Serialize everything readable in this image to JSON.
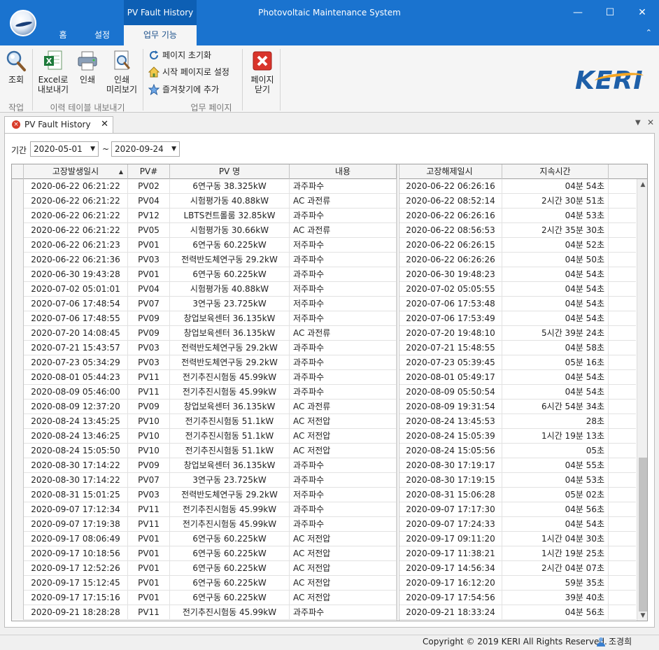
{
  "window": {
    "title": "Photovoltaic Maintenance System",
    "context_tab": "PV Fault History",
    "minimize": "—",
    "maximize": "☐",
    "close": "✕"
  },
  "tabs": [
    "홈",
    "설정",
    "업무 기능"
  ],
  "ribbon": {
    "groups": [
      "작업",
      "이력 테이블 내보내기",
      "업무 페이지"
    ],
    "buttons": {
      "search": "조회",
      "export_excel_1": "Excel로",
      "export_excel_2": "내보내기",
      "print": "인쇄",
      "preview_1": "인쇄",
      "preview_2": "미리보기",
      "page_reset": "페이지 초기화",
      "set_start_page": "시작 페이지로 설정",
      "add_favorite": "즐겨찾기에 추가",
      "close_page_1": "페이지",
      "close_page_2": "닫기"
    },
    "logo": "KERI"
  },
  "document_tab": {
    "title": "PV Fault History"
  },
  "filter": {
    "label": "기간",
    "from": "2020-05-01",
    "to": "2020-09-24",
    "separator": "~"
  },
  "table": {
    "columns": [
      "고장발생일시",
      "PV#",
      "PV 명",
      "내용",
      "고장해제일시",
      "지속시간"
    ],
    "sort_indicator": "▲",
    "rows": [
      [
        "2020-06-22 06:21:22",
        "PV02",
        "6연구동 38.325kW",
        "과주파수",
        "2020-06-22 06:26:16",
        "04분 54초"
      ],
      [
        "2020-06-22 06:21:22",
        "PV04",
        "시험평가동 40.88kW",
        "AC 과전류",
        "2020-06-22 08:52:14",
        "2시간 30분 51초"
      ],
      [
        "2020-06-22 06:21:22",
        "PV12",
        "LBTS컨트롤룸 32.85kW",
        "과주파수",
        "2020-06-22 06:26:16",
        "04분 53초"
      ],
      [
        "2020-06-22 06:21:22",
        "PV05",
        "시험평가동 30.66kW",
        "AC 과전류",
        "2020-06-22 08:56:53",
        "2시간 35분 30초"
      ],
      [
        "2020-06-22 06:21:23",
        "PV01",
        "6연구동 60.225kW",
        "저주파수",
        "2020-06-22 06:26:15",
        "04분 52초"
      ],
      [
        "2020-06-22 06:21:36",
        "PV03",
        "전력반도체연구동 29.2kW",
        "과주파수",
        "2020-06-22 06:26:26",
        "04분 50초"
      ],
      [
        "2020-06-30 19:43:28",
        "PV01",
        "6연구동 60.225kW",
        "과주파수",
        "2020-06-30 19:48:23",
        "04분 54초"
      ],
      [
        "2020-07-02 05:01:01",
        "PV04",
        "시험평가동 40.88kW",
        "저주파수",
        "2020-07-02 05:05:55",
        "04분 54초"
      ],
      [
        "2020-07-06 17:48:54",
        "PV07",
        "3연구동 23.725kW",
        "저주파수",
        "2020-07-06 17:53:48",
        "04분 54초"
      ],
      [
        "2020-07-06 17:48:55",
        "PV09",
        "창업보육센터 36.135kW",
        "저주파수",
        "2020-07-06 17:53:49",
        "04분 54초"
      ],
      [
        "2020-07-20 14:08:45",
        "PV09",
        "창업보육센터 36.135kW",
        "AC 과전류",
        "2020-07-20 19:48:10",
        "5시간 39분 24초"
      ],
      [
        "2020-07-21 15:43:57",
        "PV03",
        "전력반도체연구동 29.2kW",
        "과주파수",
        "2020-07-21 15:48:55",
        "04분 58초"
      ],
      [
        "2020-07-23 05:34:29",
        "PV03",
        "전력반도체연구동 29.2kW",
        "과주파수",
        "2020-07-23 05:39:45",
        "05분 16초"
      ],
      [
        "2020-08-01 05:44:23",
        "PV11",
        "전기추진시험동 45.99kW",
        "과주파수",
        "2020-08-01 05:49:17",
        "04분 54초"
      ],
      [
        "2020-08-09 05:46:00",
        "PV11",
        "전기추진시험동 45.99kW",
        "과주파수",
        "2020-08-09 05:50:54",
        "04분 54초"
      ],
      [
        "2020-08-09 12:37:20",
        "PV09",
        "창업보육센터 36.135kW",
        "AC 과전류",
        "2020-08-09 19:31:54",
        "6시간 54분 34초"
      ],
      [
        "2020-08-24 13:45:25",
        "PV10",
        "전기추진시험동 51.1kW",
        "AC 저전압",
        "2020-08-24 13:45:53",
        "28초"
      ],
      [
        "2020-08-24 13:46:25",
        "PV10",
        "전기추진시험동 51.1kW",
        "AC 저전압",
        "2020-08-24 15:05:39",
        "1시간 19분 13초"
      ],
      [
        "2020-08-24 15:05:50",
        "PV10",
        "전기추진시험동 51.1kW",
        "AC 저전압",
        "2020-08-24 15:05:56",
        "05초"
      ],
      [
        "2020-08-30 17:14:22",
        "PV09",
        "창업보육센터 36.135kW",
        "과주파수",
        "2020-08-30 17:19:17",
        "04분 55초"
      ],
      [
        "2020-08-30 17:14:22",
        "PV07",
        "3연구동 23.725kW",
        "과주파수",
        "2020-08-30 17:19:15",
        "04분 53초"
      ],
      [
        "2020-08-31 15:01:25",
        "PV03",
        "전력반도체연구동 29.2kW",
        "저주파수",
        "2020-08-31 15:06:28",
        "05분 02초"
      ],
      [
        "2020-09-07 17:12:34",
        "PV11",
        "전기추진시험동 45.99kW",
        "과주파수",
        "2020-09-07 17:17:30",
        "04분 56초"
      ],
      [
        "2020-09-07 17:19:38",
        "PV11",
        "전기추진시험동 45.99kW",
        "과주파수",
        "2020-09-07 17:24:33",
        "04분 54초"
      ],
      [
        "2020-09-17 08:06:49",
        "PV01",
        "6연구동 60.225kW",
        "AC 저전압",
        "2020-09-17 09:11:20",
        "1시간 04분 30초"
      ],
      [
        "2020-09-17 10:18:56",
        "PV01",
        "6연구동 60.225kW",
        "AC 저전압",
        "2020-09-17 11:38:21",
        "1시간 19분 25초"
      ],
      [
        "2020-09-17 12:52:26",
        "PV01",
        "6연구동 60.225kW",
        "AC 저전압",
        "2020-09-17 14:56:34",
        "2시간 04분 07초"
      ],
      [
        "2020-09-17 15:12:45",
        "PV01",
        "6연구동 60.225kW",
        "AC 저전압",
        "2020-09-17 16:12:20",
        "59분 35초"
      ],
      [
        "2020-09-17 17:15:16",
        "PV01",
        "6연구동 60.225kW",
        "AC 저전압",
        "2020-09-17 17:54:56",
        "39분 40초"
      ],
      [
        "2020-09-21 18:28:28",
        "PV11",
        "전기추진시험동 45.99kW",
        "과주파수",
        "2020-09-21 18:33:24",
        "04분 56초"
      ]
    ]
  },
  "status_bar": {
    "copyright": "Copyright © 2019 KERI All Rights Reserved.",
    "user": "조경희"
  },
  "colors": {
    "title_bar": "#1a73cf",
    "context_tab": "#0d5fb4",
    "logo": "#1e5fa8"
  }
}
